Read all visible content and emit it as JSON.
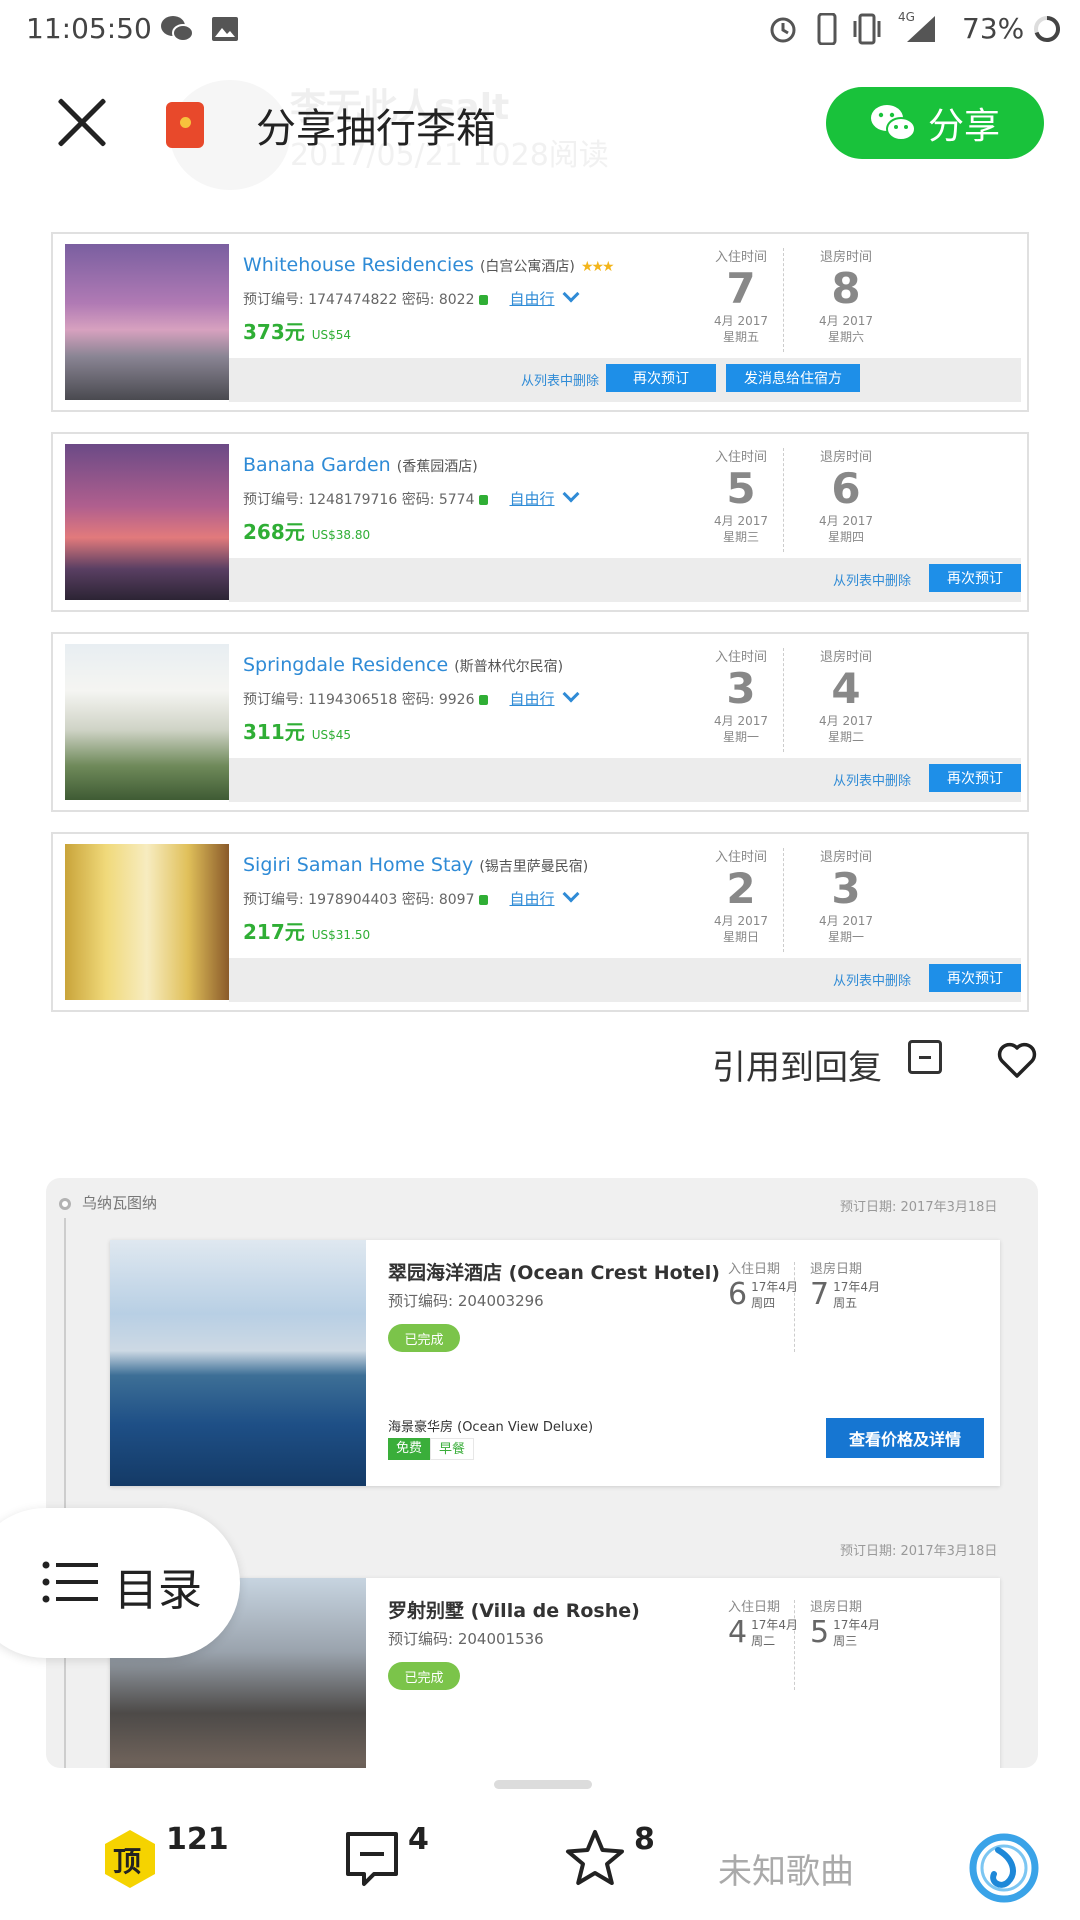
{
  "status_bar": {
    "time": "11:05:50",
    "network": "4G",
    "battery": "73%"
  },
  "top_bar": {
    "title": "分享抽行李箱",
    "share_label": "分享",
    "faded_author": "李无此人salt",
    "faded_meta": "2017/05/21 1028阅读"
  },
  "reservations": [
    {
      "name": "Whitehouse Residencies",
      "name_cn": "(白宫公寓酒店)",
      "stars": "★★★",
      "meta": "预订编号: 1747474822 密码: 8022",
      "tag": "自由行",
      "price": "373元",
      "price_usd": "US$54",
      "checkin_label": "入住时间",
      "checkin_day": "7",
      "checkin_month": "4月 2017",
      "checkin_week": "星期五",
      "checkout_label": "退房时间",
      "checkout_day": "8",
      "checkout_month": "4月 2017",
      "checkout_week": "星期六",
      "remove": "从列表中删除",
      "rebook": "再次预订",
      "send": "发消息给住宿方"
    },
    {
      "name": "Banana Garden",
      "name_cn": "(香蕉园酒店)",
      "stars": "",
      "meta": "预订编号: 1248179716 密码: 5774",
      "tag": "自由行",
      "price": "268元",
      "price_usd": "US$38.80",
      "checkin_label": "入住时间",
      "checkin_day": "5",
      "checkin_month": "4月 2017",
      "checkin_week": "星期三",
      "checkout_label": "退房时间",
      "checkout_day": "6",
      "checkout_month": "4月 2017",
      "checkout_week": "星期四",
      "remove": "从列表中删除",
      "rebook": "再次预订",
      "send": ""
    },
    {
      "name": "Springdale Residence",
      "name_cn": "(斯普林代尔民宿)",
      "stars": "",
      "meta": "预订编号: 1194306518 密码: 9926",
      "tag": "自由行",
      "price": "311元",
      "price_usd": "US$45",
      "checkin_label": "入住时间",
      "checkin_day": "3",
      "checkin_month": "4月 2017",
      "checkin_week": "星期一",
      "checkout_label": "退房时间",
      "checkout_day": "4",
      "checkout_month": "4月 2017",
      "checkout_week": "星期二",
      "remove": "从列表中删除",
      "rebook": "再次预订",
      "send": ""
    },
    {
      "name": "Sigiri Saman Home Stay",
      "name_cn": "(锡吉里萨曼民宿)",
      "stars": "",
      "meta": "预订编号: 1978904403 密码: 8097",
      "tag": "自由行",
      "price": "217元",
      "price_usd": "US$31.50",
      "checkin_label": "入住时间",
      "checkin_day": "2",
      "checkin_month": "4月 2017",
      "checkin_week": "星期日",
      "checkout_label": "退房时间",
      "checkout_day": "3",
      "checkout_month": "4月 2017",
      "checkout_week": "星期一",
      "remove": "从列表中删除",
      "rebook": "再次预订",
      "send": ""
    }
  ],
  "quote_reply": "引用到回复",
  "panel": {
    "city": "乌纳瓦图纳",
    "booking_date": "预订日期: 2017年3月18日",
    "hotels": [
      {
        "name": "翠园海洋酒店 (Ocean Crest Hotel)",
        "code": "预订编码: 204003296",
        "status": "已完成",
        "checkin_label": "入住日期",
        "checkin_day": "6",
        "checkin_ym": "17年4月",
        "checkin_week": "周四",
        "checkout_label": "退房日期",
        "checkout_day": "7",
        "checkout_ym": "17年4月",
        "checkout_week": "周五",
        "room": "海景豪华房 (Ocean View Deluxe)",
        "free": "免费",
        "breakfast": "早餐",
        "detail": "查看价格及详情"
      },
      {
        "name": "罗射别墅 (Villa de Roshe)",
        "code": "预订编码: 204001536",
        "status": "已完成",
        "booking_date": "预订日期: 2017年3月18日",
        "checkin_label": "入住日期",
        "checkin_day": "4",
        "checkin_ym": "17年4月",
        "checkin_week": "周二",
        "checkout_label": "退房日期",
        "checkout_day": "5",
        "checkout_ym": "17年4月",
        "checkout_week": "周三"
      }
    ]
  },
  "toc_label": "目录",
  "bottom_bar": {
    "top_label": "顶",
    "top_count": "121",
    "comment_count": "4",
    "fav_count": "8",
    "song": "未知歌曲"
  },
  "colors": {
    "share_green": "#19c23b",
    "link_blue": "#2f8bd6",
    "button_blue": "#1e8fe8",
    "price_green": "#2fae35",
    "top_badge": "#f5d300"
  }
}
